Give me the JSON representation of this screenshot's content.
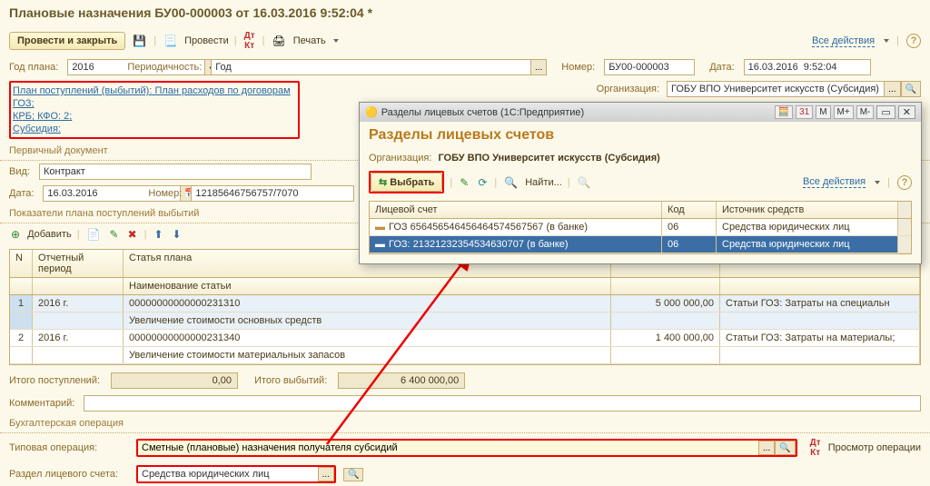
{
  "title": "Плановые назначения БУ00-000003 от 16.03.2016 9:52:04 *",
  "toolbar": {
    "post_close": "Провести и закрыть",
    "post": "Провести",
    "print": "Печать",
    "all_actions": "Все действия"
  },
  "header": {
    "year_plan_label": "Год плана:",
    "year_plan": "2016",
    "periodicity_label": "Периодичность:",
    "periodicity": "Год",
    "number_label": "Номер:",
    "number": "БУ00-000003",
    "date_label": "Дата:",
    "date": "16.03.2016  9:52:04",
    "org_label": "Организация:",
    "org": "ГОБУ ВПО Университет искусств (Субсидия)"
  },
  "links": {
    "plan": "План поступлений (выбытий): План расходов по договорам ГОЗ;",
    "krb": "КРБ; КФО: 2;",
    "subsidy": "Субсидия:"
  },
  "primary_doc": {
    "section": "Первичный документ",
    "kind_label": "Вид:",
    "kind": "Контракт",
    "date_label": "Дата:",
    "date": "16.03.2016",
    "number_label": "Номер:",
    "number": "12185646756757/7070"
  },
  "plan_section": {
    "title": "Показатели плана поступлений выбытий",
    "add": "Добавить",
    "cols": {
      "n": "N",
      "period": "Отчетный период",
      "article": "Статья плана",
      "article_name": "Наименование статьи"
    },
    "rows": [
      {
        "n": "1",
        "period": "2016 г.",
        "article": "00000000000000231310",
        "article_name": "Увеличение стоимости основных средств",
        "sum": "5 000 000,00",
        "goz": "Статьи ГОЗ: Затраты на специальн"
      },
      {
        "n": "2",
        "period": "2016 г.",
        "article": "00000000000000231340",
        "article_name": "Увеличение стоимости материальных запасов",
        "sum": "1 400 000,00",
        "goz": "Статьи ГОЗ: Затраты на материалы;"
      }
    ]
  },
  "totals": {
    "in_label": "Итого поступлений:",
    "in": "0,00",
    "out_label": "Итого выбытий:",
    "out": "6 400 000,00"
  },
  "comment_label": "Комментарий:",
  "booking_section": "Бухгалтерская операция",
  "typical_op": {
    "label": "Типовая операция:",
    "value": "Сметные (плановые) назначения получателя субсидий",
    "preview": "Просмотр операции"
  },
  "account_section": {
    "label": "Раздел лицевого счета:",
    "value": "Средства юридических лиц"
  },
  "popup": {
    "title_bar": "Разделы лицевых счетов  (1С:Предприятие)",
    "header": "Разделы лицевых счетов",
    "org_label": "Организация:",
    "org": "ГОБУ ВПО Университет искусств (Субсидия)",
    "select": "Выбрать",
    "find": "Найти...",
    "all_actions": "Все действия",
    "cols": {
      "account": "Лицевой счет",
      "code": "Код",
      "source": "Источник средств"
    },
    "rows": [
      {
        "account": "ГОЗ 656456546456464574567567 (в банке)",
        "code": "06",
        "source": "Средства юридических лиц"
      },
      {
        "account": "ГОЗ: 21321232354534630707 (в банке)",
        "code": "06",
        "source": "Средства юридических лиц"
      }
    ]
  }
}
